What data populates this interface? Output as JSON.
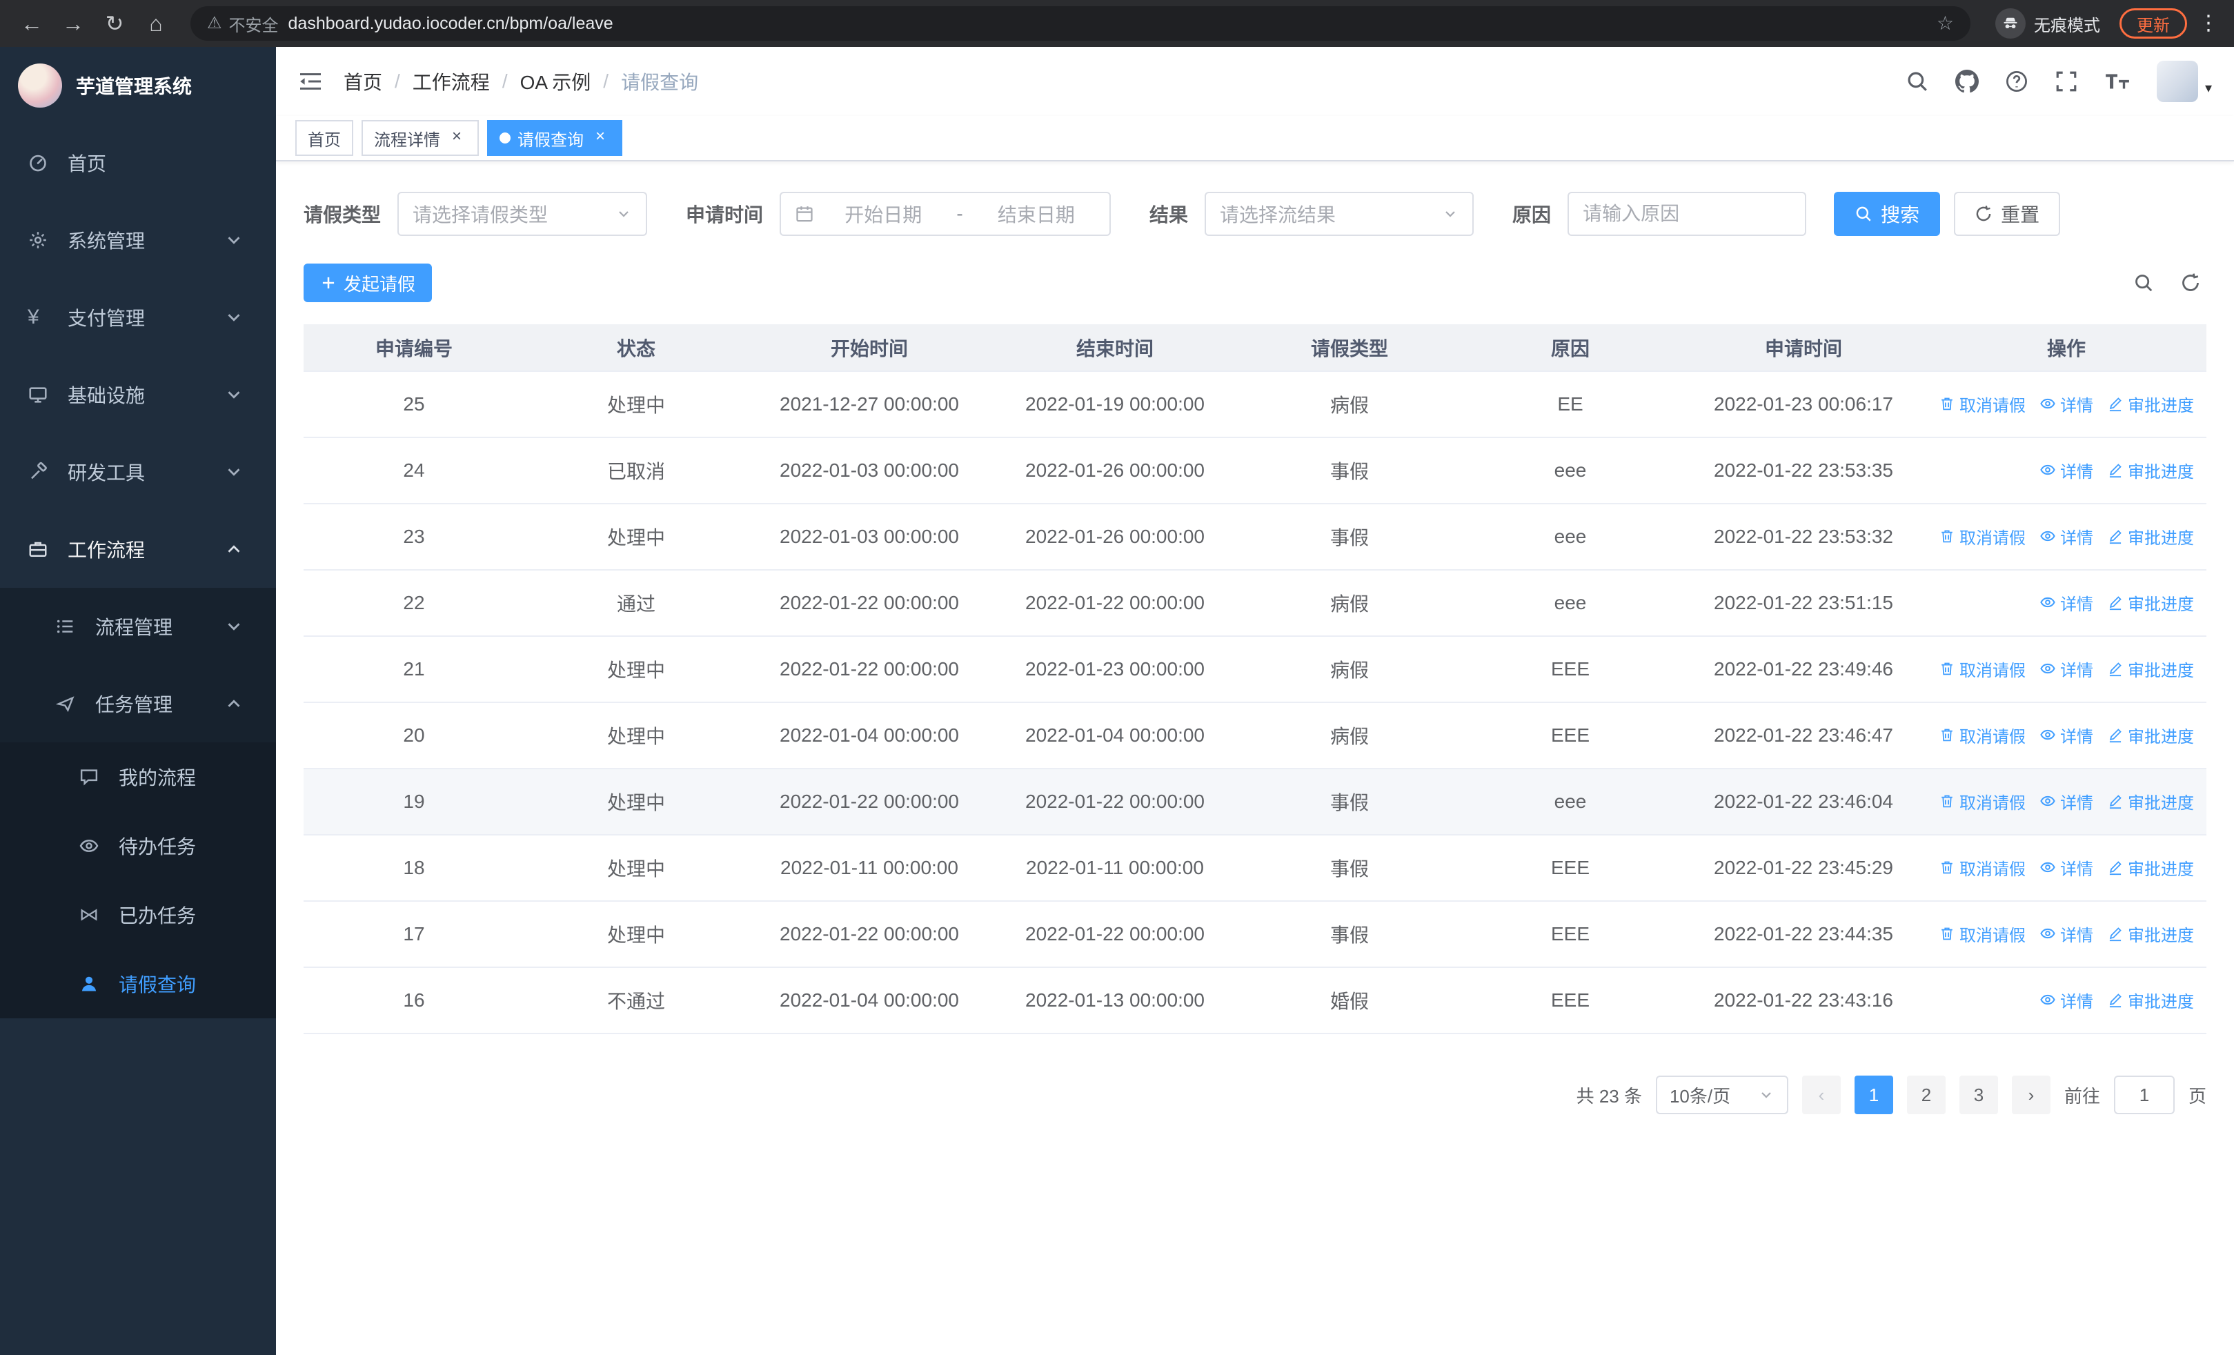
{
  "browser": {
    "security_label": "不安全",
    "url": "dashboard.yudao.iocoder.cn/bpm/oa/leave",
    "incognito_label": "无痕模式",
    "update_label": "更新"
  },
  "sidebar": {
    "title": "芋道管理系统",
    "items": [
      {
        "label": "首页",
        "icon": "dashboard-icon",
        "level": 1
      },
      {
        "label": "系统管理",
        "icon": "gear-icon",
        "level": 1,
        "chevron": "down"
      },
      {
        "label": "支付管理",
        "icon": "yen-icon",
        "level": 1,
        "chevron": "down"
      },
      {
        "label": "基础设施",
        "icon": "monitor-icon",
        "level": 1,
        "chevron": "down"
      },
      {
        "label": "研发工具",
        "icon": "tools-icon",
        "level": 1,
        "chevron": "down"
      },
      {
        "label": "工作流程",
        "icon": "briefcase-icon",
        "level": 1,
        "chevron": "up",
        "open": true
      },
      {
        "label": "流程管理",
        "icon": "list-icon",
        "level": 2,
        "chevron": "down"
      },
      {
        "label": "任务管理",
        "icon": "flag-icon",
        "level": 2,
        "chevron": "up"
      },
      {
        "label": "我的流程",
        "icon": "comment-icon",
        "level": 3
      },
      {
        "label": "待办任务",
        "icon": "eye-icon",
        "level": 3
      },
      {
        "label": "已办任务",
        "icon": "bowtie-icon",
        "level": 3
      },
      {
        "label": "请假查询",
        "icon": "user-icon",
        "level": 3,
        "active": true
      }
    ]
  },
  "header": {
    "breadcrumb": [
      {
        "label": "首页"
      },
      {
        "label": "工作流程"
      },
      {
        "label": "OA 示例"
      },
      {
        "label": "请假查询",
        "current": true
      }
    ]
  },
  "tabs": [
    {
      "label": "首页",
      "closable": false,
      "active": false
    },
    {
      "label": "流程详情",
      "closable": true,
      "active": false
    },
    {
      "label": "请假查询",
      "closable": true,
      "active": true
    }
  ],
  "filters": {
    "leave_type_label": "请假类型",
    "leave_type_placeholder": "请选择请假类型",
    "apply_time_label": "申请时间",
    "start_date_placeholder": "开始日期",
    "range_separator": "-",
    "end_date_placeholder": "结束日期",
    "result_label": "结果",
    "result_placeholder": "请选择流结果",
    "reason_label": "原因",
    "reason_placeholder": "请输入原因",
    "search_label": "搜索",
    "reset_label": "重置"
  },
  "toolbar": {
    "create_label": "发起请假"
  },
  "table": {
    "columns": [
      "申请编号",
      "状态",
      "开始时间",
      "结束时间",
      "请假类型",
      "原因",
      "申请时间",
      "操作"
    ],
    "rows": [
      {
        "id": "25",
        "status": "处理中",
        "start": "2021-12-27 00:00:00",
        "end": "2022-01-19 00:00:00",
        "type": "病假",
        "reason": "EE",
        "apply_time": "2022-01-23 00:06:17",
        "actions": [
          {
            "label": "取消请假",
            "icon": "delete-icon"
          },
          {
            "label": "详情",
            "icon": "view-icon"
          },
          {
            "label": "审批进度",
            "icon": "edit-icon"
          }
        ]
      },
      {
        "id": "24",
        "status": "已取消",
        "start": "2022-01-03 00:00:00",
        "end": "2022-01-26 00:00:00",
        "type": "事假",
        "reason": "eee",
        "apply_time": "2022-01-22 23:53:35",
        "actions": [
          {
            "label": "详情",
            "icon": "view-icon"
          },
          {
            "label": "审批进度",
            "icon": "edit-icon"
          }
        ]
      },
      {
        "id": "23",
        "status": "处理中",
        "start": "2022-01-03 00:00:00",
        "end": "2022-01-26 00:00:00",
        "type": "事假",
        "reason": "eee",
        "apply_time": "2022-01-22 23:53:32",
        "actions": [
          {
            "label": "取消请假",
            "icon": "delete-icon"
          },
          {
            "label": "详情",
            "icon": "view-icon"
          },
          {
            "label": "审批进度",
            "icon": "edit-icon"
          }
        ]
      },
      {
        "id": "22",
        "status": "通过",
        "start": "2022-01-22 00:00:00",
        "end": "2022-01-22 00:00:00",
        "type": "病假",
        "reason": "eee",
        "apply_time": "2022-01-22 23:51:15",
        "actions": [
          {
            "label": "详情",
            "icon": "view-icon"
          },
          {
            "label": "审批进度",
            "icon": "edit-icon"
          }
        ]
      },
      {
        "id": "21",
        "status": "处理中",
        "start": "2022-01-22 00:00:00",
        "end": "2022-01-23 00:00:00",
        "type": "病假",
        "reason": "EEE",
        "apply_time": "2022-01-22 23:49:46",
        "actions": [
          {
            "label": "取消请假",
            "icon": "delete-icon"
          },
          {
            "label": "详情",
            "icon": "view-icon"
          },
          {
            "label": "审批进度",
            "icon": "edit-icon"
          }
        ]
      },
      {
        "id": "20",
        "status": "处理中",
        "start": "2022-01-04 00:00:00",
        "end": "2022-01-04 00:00:00",
        "type": "病假",
        "reason": "EEE",
        "apply_time": "2022-01-22 23:46:47",
        "actions": [
          {
            "label": "取消请假",
            "icon": "delete-icon"
          },
          {
            "label": "详情",
            "icon": "view-icon"
          },
          {
            "label": "审批进度",
            "icon": "edit-icon"
          }
        ]
      },
      {
        "id": "19",
        "status": "处理中",
        "start": "2022-01-22 00:00:00",
        "end": "2022-01-22 00:00:00",
        "type": "事假",
        "reason": "eee",
        "apply_time": "2022-01-22 23:46:04",
        "highlight": true,
        "actions": [
          {
            "label": "取消请假",
            "icon": "delete-icon"
          },
          {
            "label": "详情",
            "icon": "view-icon"
          },
          {
            "label": "审批进度",
            "icon": "edit-icon"
          }
        ]
      },
      {
        "id": "18",
        "status": "处理中",
        "start": "2022-01-11 00:00:00",
        "end": "2022-01-11 00:00:00",
        "type": "事假",
        "reason": "EEE",
        "apply_time": "2022-01-22 23:45:29",
        "actions": [
          {
            "label": "取消请假",
            "icon": "delete-icon"
          },
          {
            "label": "详情",
            "icon": "view-icon"
          },
          {
            "label": "审批进度",
            "icon": "edit-icon"
          }
        ]
      },
      {
        "id": "17",
        "status": "处理中",
        "start": "2022-01-22 00:00:00",
        "end": "2022-01-22 00:00:00",
        "type": "事假",
        "reason": "EEE",
        "apply_time": "2022-01-22 23:44:35",
        "actions": [
          {
            "label": "取消请假",
            "icon": "delete-icon"
          },
          {
            "label": "详情",
            "icon": "view-icon"
          },
          {
            "label": "审批进度",
            "icon": "edit-icon"
          }
        ]
      },
      {
        "id": "16",
        "status": "不通过",
        "start": "2022-01-04 00:00:00",
        "end": "2022-01-13 00:00:00",
        "type": "婚假",
        "reason": "EEE",
        "apply_time": "2022-01-22 23:43:16",
        "actions": [
          {
            "label": "详情",
            "icon": "view-icon"
          },
          {
            "label": "审批进度",
            "icon": "edit-icon"
          }
        ]
      }
    ]
  },
  "pagination": {
    "total_label": "共 23 条",
    "page_size_value": "10条/页",
    "pages": [
      "1",
      "2",
      "3"
    ],
    "active_page": "1",
    "goto_label": "前往",
    "goto_value": "1",
    "unit_label": "页"
  },
  "colors": {
    "primary": "#409eff",
    "sidebar_bg": "#1f2d3d",
    "update_chip": "#ff6e40"
  }
}
